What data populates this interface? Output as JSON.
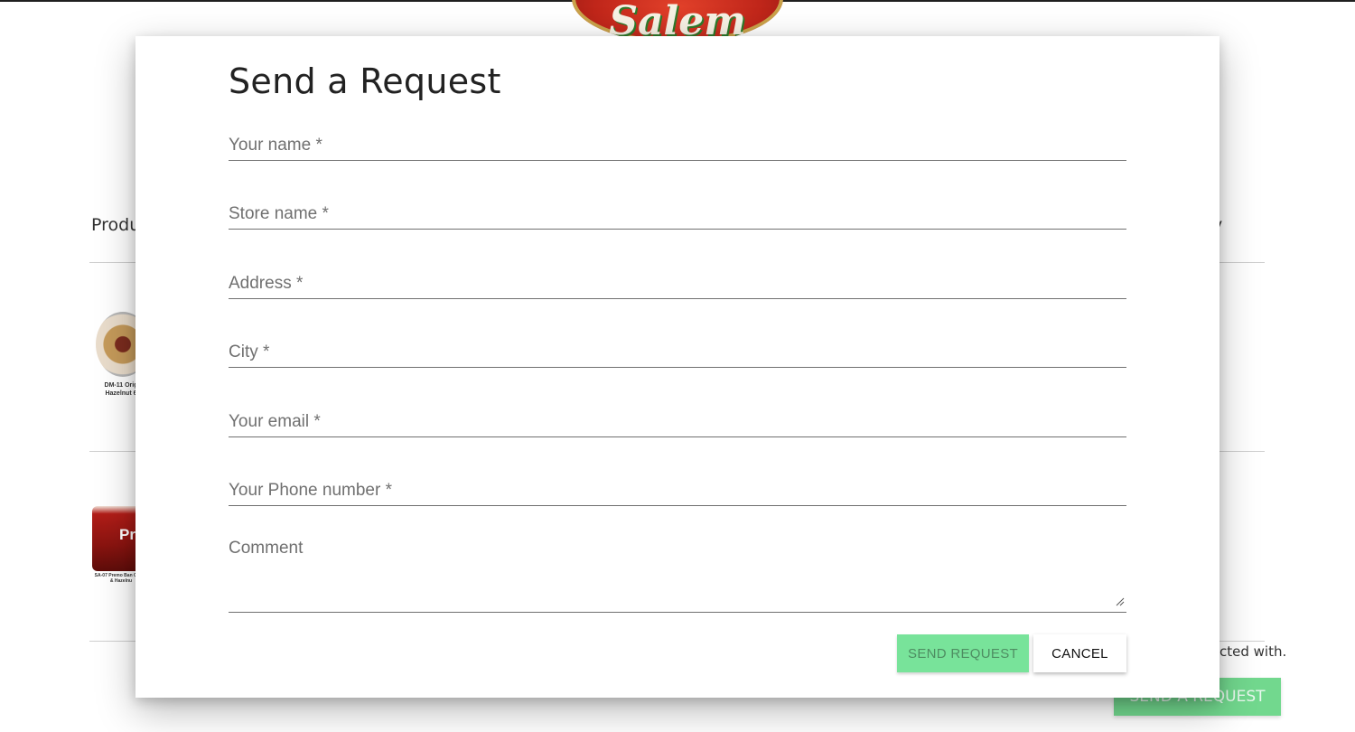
{
  "background": {
    "logo_text": "Salem",
    "column_header_left": "Produ",
    "column_header_right": "y",
    "product_1_caption": "DM-11 Orig Hazelnut 6",
    "product_2_badge": "Pr",
    "product_2_caption": "SA-07 Premo Ban Cocoa & Hazelnu",
    "note_text": "cted with.",
    "send_button_label": "SEND A REQUEST"
  },
  "modal": {
    "title": "Send a Request",
    "fields": {
      "name_placeholder": "Your name *",
      "store_placeholder": "Store name *",
      "address_placeholder": "Address *",
      "city_placeholder": "City *",
      "email_placeholder": "Your email *",
      "phone_placeholder": "Your Phone number *",
      "comment_placeholder": "Comment"
    },
    "send_label": "SEND REQUEST",
    "cancel_label": "CANCEL"
  },
  "colors": {
    "send_button": "#78e39a",
    "send_button_text": "#4e8d62",
    "field_underline": "#707070"
  }
}
